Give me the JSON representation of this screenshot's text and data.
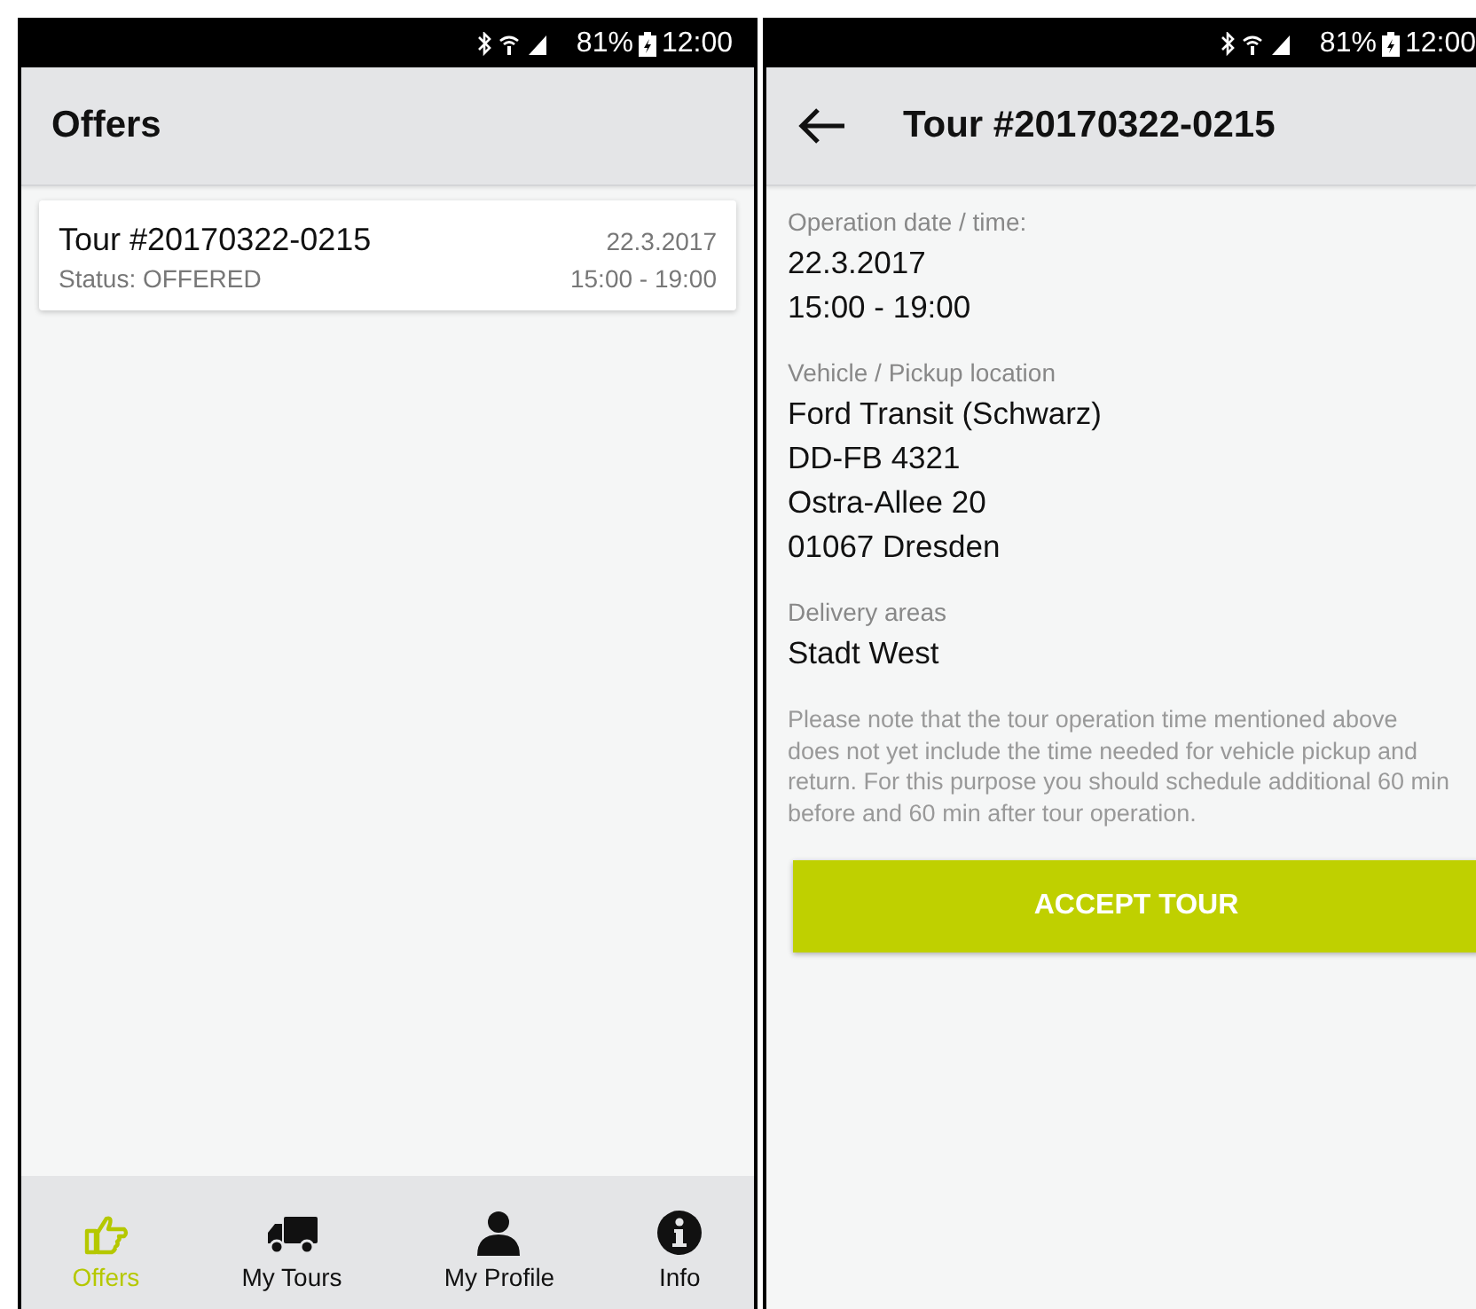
{
  "screens": [
    {
      "status_bar": {
        "battery": "81%",
        "time": "12:00"
      },
      "header": {
        "title": "Offers"
      },
      "offers": [
        {
          "title": "Tour #20170322-0215",
          "date": "22.3.2017",
          "status": "Status: OFFERED",
          "time": "15:00 - 19:00"
        }
      ],
      "bottom_nav": [
        {
          "kind": "offers",
          "label": "Offers",
          "selected": true
        },
        {
          "kind": "tours",
          "label": "My Tours",
          "selected": false
        },
        {
          "kind": "profile",
          "label": "My Profile",
          "selected": false
        },
        {
          "kind": "info",
          "label": "Info",
          "selected": false
        }
      ]
    },
    {
      "status_bar": {
        "battery": "81%",
        "time": "12:00"
      },
      "header": {
        "title": "Tour #20170322-0215"
      },
      "sections": [
        {
          "label": "Operation date / time:",
          "lines": [
            "22.3.2017",
            "15:00 - 19:00"
          ]
        },
        {
          "label": "Vehicle / Pickup location",
          "lines": [
            "Ford Transit (Schwarz)",
            "DD-FB 4321",
            "Ostra-Allee 20",
            "01067 Dresden"
          ]
        },
        {
          "label": "Delivery areas",
          "lines": [
            "Stadt West"
          ]
        }
      ],
      "note": "Please note that the tour operation time mentioned above does not yet include the time needed for vehicle pickup and return. For this purpose you should schedule additional 60 min before and 60 min after tour operation.",
      "accept_button": "ACCEPT TOUR"
    }
  ]
}
